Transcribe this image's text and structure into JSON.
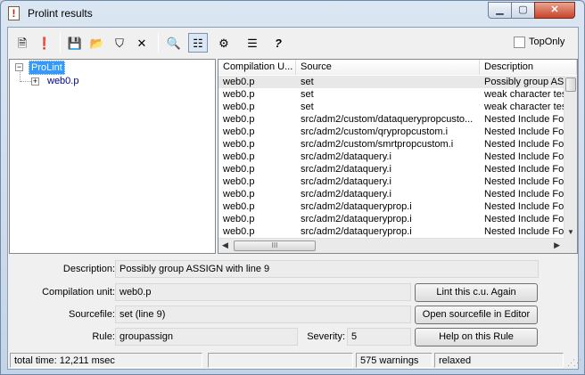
{
  "window": {
    "title": "Prolint results",
    "title_icon": "prolint-app-icon",
    "caption_buttons": {
      "minimize": "▁",
      "maximize": "▢",
      "close": "✕"
    }
  },
  "toolbar": {
    "items": [
      {
        "icon": "lint-run-icon",
        "glyph": "🗎"
      },
      {
        "icon": "warning-doc-icon",
        "glyph": "❗"
      },
      {
        "icon": "save-icon",
        "glyph": "💾"
      },
      {
        "icon": "open-folder-icon",
        "glyph": "📂"
      },
      {
        "icon": "filter-icon",
        "glyph": "⛉"
      },
      {
        "icon": "delete-icon",
        "glyph": "✕"
      },
      {
        "icon": "find-icon",
        "glyph": "🔍"
      },
      {
        "icon": "tree-view-icon",
        "glyph": "☷"
      },
      {
        "icon": "rules-icon",
        "glyph": "⚙"
      },
      {
        "icon": "list-report-icon",
        "glyph": "☰"
      },
      {
        "icon": "help-icon",
        "glyph": "?"
      }
    ],
    "toponly_label": "TopOnly",
    "toponly_checked": false
  },
  "tree": {
    "root": {
      "label": "ProLint",
      "expander": "−",
      "selected": true
    },
    "child": {
      "label": "web0.p",
      "expander": "+"
    }
  },
  "list": {
    "columns": [
      "Compilation U...",
      "Source",
      "Description"
    ],
    "rows": [
      [
        "web0.p",
        "set",
        "Possibly group ASS"
      ],
      [
        "web0.p",
        "set",
        "weak character tes"
      ],
      [
        "web0.p",
        "set",
        "weak character tes"
      ],
      [
        "web0.p",
        "src/adm2/custom/dataquerypropcusto...",
        "Nested Include Fo"
      ],
      [
        "web0.p",
        "src/adm2/custom/qrypropcustom.i",
        "Nested Include Fo"
      ],
      [
        "web0.p",
        "src/adm2/custom/smrtpropcustom.i",
        "Nested Include Fo"
      ],
      [
        "web0.p",
        "src/adm2/dataquery.i",
        "Nested Include Fo"
      ],
      [
        "web0.p",
        "src/adm2/dataquery.i",
        "Nested Include Fo"
      ],
      [
        "web0.p",
        "src/adm2/dataquery.i",
        "Nested Include Fo"
      ],
      [
        "web0.p",
        "src/adm2/dataquery.i",
        "Nested Include Fo"
      ],
      [
        "web0.p",
        "src/adm2/dataqueryprop.i",
        "Nested Include Fo"
      ],
      [
        "web0.p",
        "src/adm2/dataqueryprop.i",
        "Nested Include Fo"
      ],
      [
        "web0.p",
        "src/adm2/dataqueryprop.i",
        "Nested Include Fo"
      ]
    ],
    "selected_row": 0,
    "hscroll_grip": "III"
  },
  "details": {
    "description_label": "Description:",
    "description_value": "Possibly group ASSIGN with line 9",
    "compilation_unit_label": "Compilation unit:",
    "compilation_unit_value": "web0.p",
    "sourcefile_label": "Sourcefile:",
    "sourcefile_value": "set (line 9)",
    "rule_label": "Rule:",
    "rule_value": "groupassign",
    "severity_label": "Severity:",
    "severity_value": "5"
  },
  "buttons": {
    "lint_again": "Lint this c.u. Again",
    "open_source": "Open sourcefile in Editor",
    "help_rule": "Help on this Rule"
  },
  "status": {
    "total_time": "total time: 12,211 msec",
    "empty": "",
    "warnings": "575 warnings",
    "mode": "relaxed"
  }
}
